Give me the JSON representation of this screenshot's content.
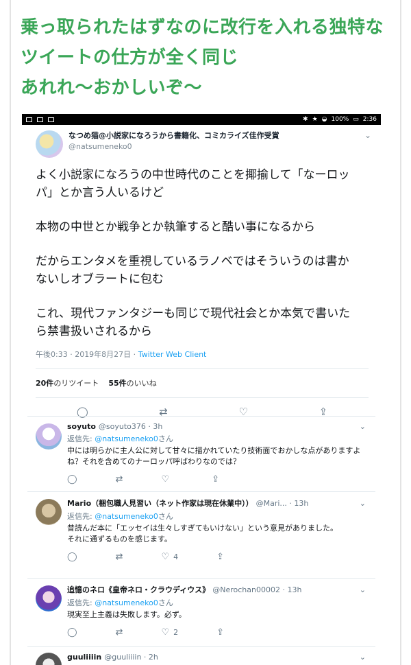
{
  "headline": {
    "line1": "乗っ取られたはずなのに改行を入れる独特な",
    "line2": "ツイートの仕方が全く同じ",
    "line3": "あれれ〜おかしいぞ〜"
  },
  "statusbar": {
    "battery": "100%",
    "time": "2:36"
  },
  "main_tweet": {
    "name": "なつめ猫@小説家になろうから書籍化、コミカライズ佳作受賞",
    "handle": "@natsumeneko0",
    "paragraphs": [
      "よく小説家になろうの中世時代のことを揶揄して「なーロッパ」とか言う人いるけど",
      "本物の中世とか戦争とか執筆すると酷い事になるから",
      "だからエンタメを重視しているラノベではそういうのは書かないしオブラートに包む",
      "これ、現代ファンタジーも同じで現代社会とか本気で書いたら禁書扱いされるから"
    ],
    "timestamp": "午後0:33 · 2019年8月27日 ·",
    "client": "Twitter Web Client",
    "retweets_count": "20件",
    "retweets_label": "のリツイート",
    "likes_count": "55件",
    "likes_label": "のいいね"
  },
  "reply_to_prefix": "返信先:",
  "reply_to_handle": "@natsumeneko0",
  "reply_to_suffix": "さん",
  "replies": [
    {
      "name": "soyuto",
      "handle": "@soyuto376 · 3h",
      "text": "中には明らかに主人公に対して甘々に描かれていたり技術面でおかしな点がありますよね？それを含めてのナーロッパ呼ばわりなのでは？",
      "likes": ""
    },
    {
      "name": "Mario（梱包職人見習い（ネット作家は現在休業中））",
      "handle": "@Mari... · 13h",
      "text": "昔読んだ本に「エッセイは生々しすぎてもいけない」という意見がありました。\nそれに通ずるものを感じます。",
      "likes": "4"
    },
    {
      "name": "追憶のネロ《皇帝ネロ・クラウディウス》",
      "handle": "@Nerochan00002 · 13h",
      "text": "現実至上主義は失敗します。必ず。",
      "likes": "2"
    },
    {
      "name": "guuliiiin",
      "handle": "@guuliiiin · 2h",
      "text": "",
      "likes": ""
    }
  ],
  "icons": [
    "reply-icon",
    "retweet-icon",
    "like-icon",
    "share-icon",
    "chevron-down-icon"
  ],
  "colors": {
    "headline": "#3aa657",
    "link": "#1da1f2",
    "muted": "#657786"
  }
}
